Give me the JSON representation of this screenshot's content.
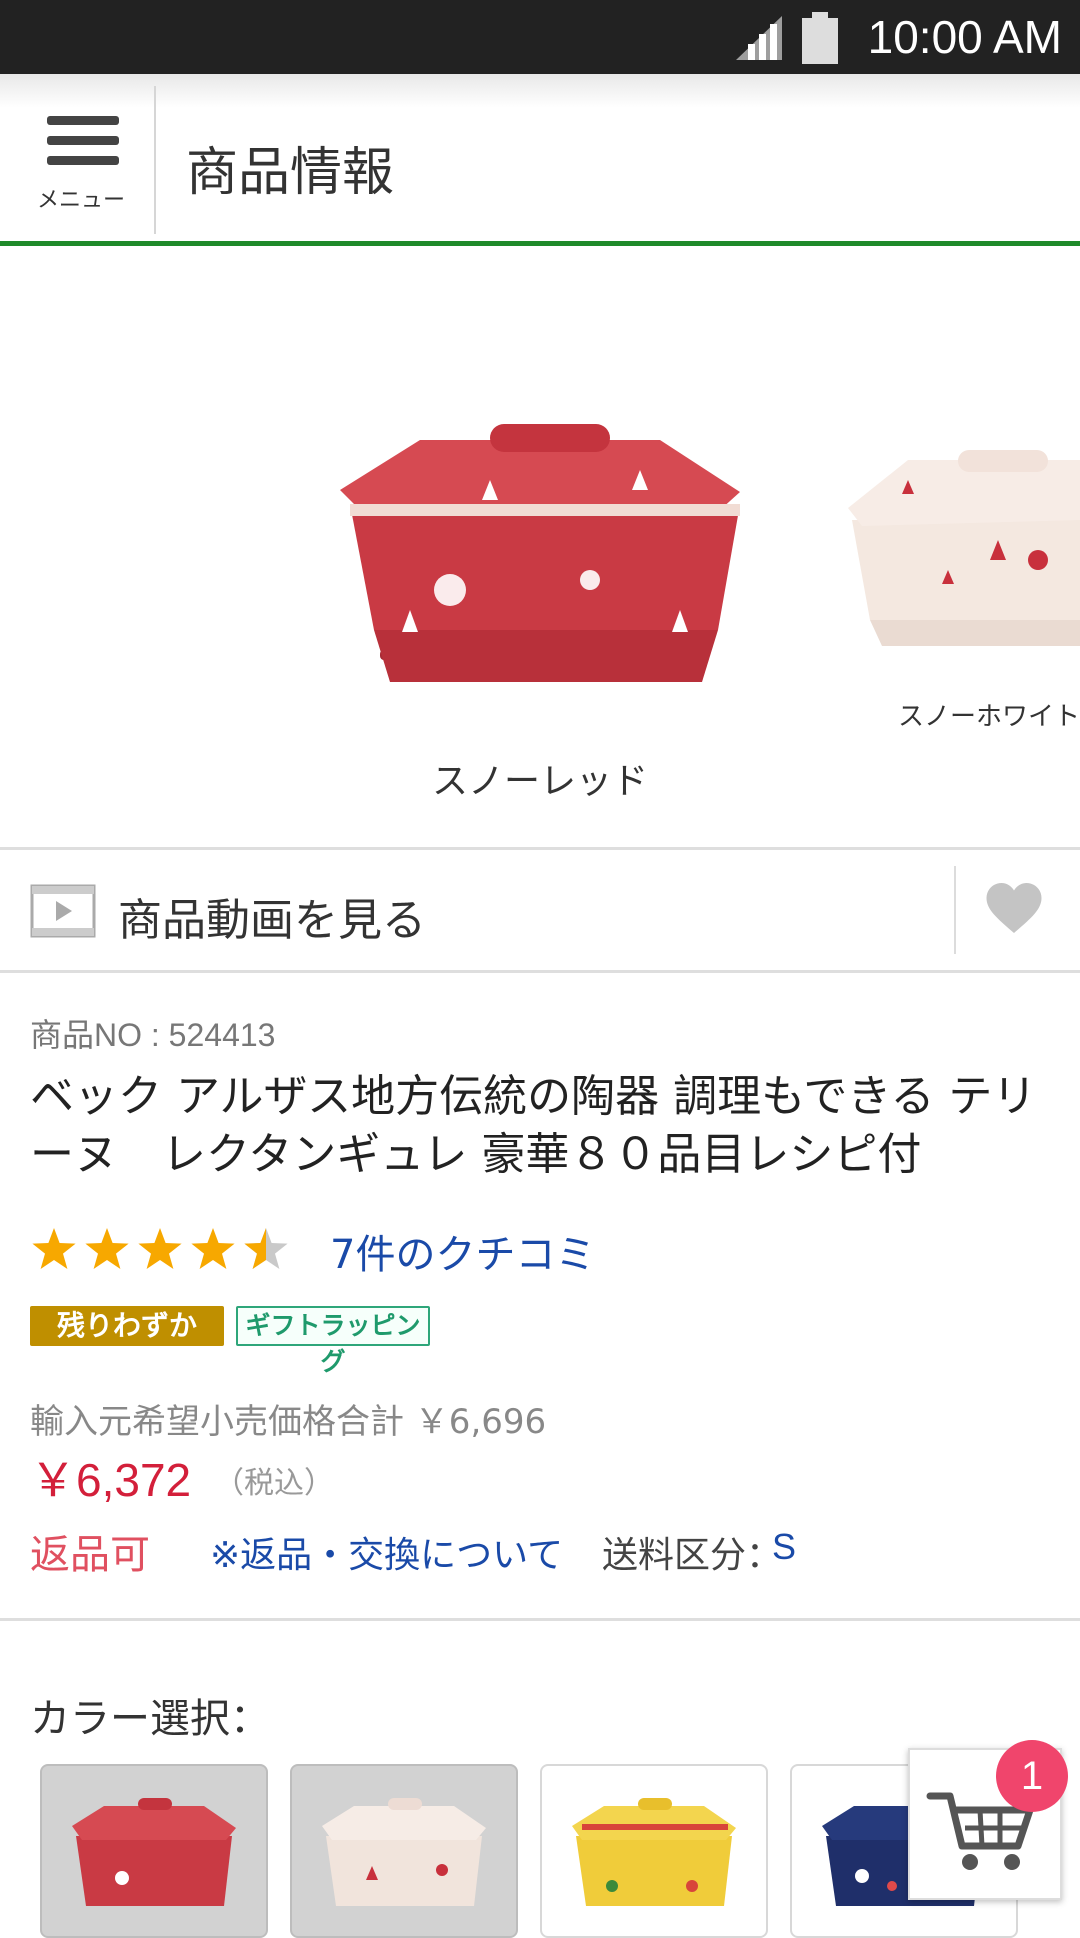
{
  "status_bar": {
    "time": "10:00 AM",
    "signal_icon": "signal-icon",
    "battery_icon": "battery-icon"
  },
  "header": {
    "menu_label": "メニュー",
    "title": "商品情報"
  },
  "carousel": {
    "main_caption": "スノーレッド",
    "side_caption": "スノーホワイト"
  },
  "video": {
    "label": "商品動画を見る"
  },
  "product": {
    "number": "商品NO : 524413",
    "name": "ベック アルザス地方伝統の陶器 調理もできる テリーヌ　レクタンギュレ 豪華８０品目レシピ付",
    "rating": 4.5,
    "review_link": "7件のクチコミ",
    "badge_few": "残りわずか",
    "badge_gift": "ギフトラッピング",
    "list_price": "輸入元希望小売価格合計 ￥6,696",
    "price": "￥6,372",
    "tax": "（税込）",
    "returnable": "返品可",
    "return_link": "※返品・交換について",
    "ship_label": "送料区分：",
    "ship_value": "S"
  },
  "colors": {
    "label": "カラー選択："
  },
  "cart": {
    "count": "1"
  },
  "theme": {
    "accent_green": "#1f8a2a",
    "price_red": "#d31f3a",
    "link_blue": "#1a4aa8",
    "star": "#f7a800"
  }
}
